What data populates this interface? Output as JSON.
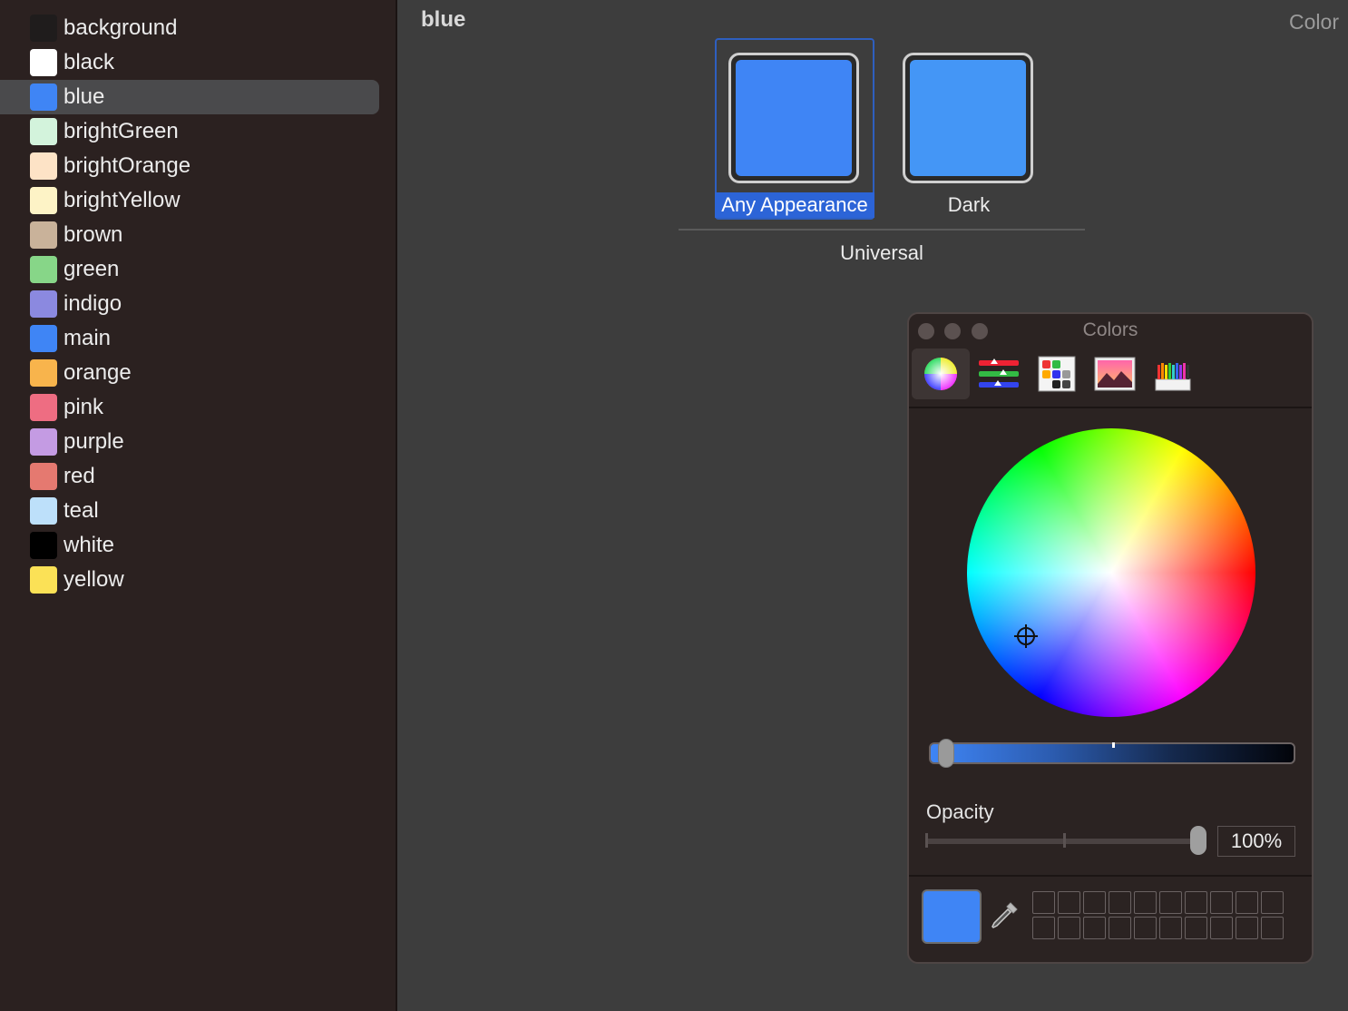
{
  "window": {
    "title": "blue",
    "inspector_title": "Color"
  },
  "sidebar": {
    "selected_index": 2,
    "items": [
      {
        "label": "background",
        "swatch": "#1f1c1c"
      },
      {
        "label": "black",
        "swatch": "#ffffff"
      },
      {
        "label": "blue",
        "swatch": "#3f85f5"
      },
      {
        "label": "brightGreen",
        "swatch": "#d3f3dc"
      },
      {
        "label": "brightOrange",
        "swatch": "#fde3c6"
      },
      {
        "label": "brightYellow",
        "swatch": "#fdf3c6"
      },
      {
        "label": "brown",
        "swatch": "#c9b29a"
      },
      {
        "label": "green",
        "swatch": "#87d688"
      },
      {
        "label": "indigo",
        "swatch": "#8b89e0"
      },
      {
        "label": "main",
        "swatch": "#3f85f5"
      },
      {
        "label": "orange",
        "swatch": "#f8b44c"
      },
      {
        "label": "pink",
        "swatch": "#ee6d82"
      },
      {
        "label": "purple",
        "swatch": "#c49be3"
      },
      {
        "label": "red",
        "swatch": "#e57970"
      },
      {
        "label": "teal",
        "swatch": "#bde0fa"
      },
      {
        "label": "white",
        "swatch": "#000000"
      },
      {
        "label": "yellow",
        "swatch": "#fbe156"
      }
    ]
  },
  "appearances": {
    "any": {
      "label": "Any Appearance",
      "color": "#3f85f5"
    },
    "dark": {
      "label": "Dark",
      "color": "#4496f6"
    },
    "group_label": "Universal"
  },
  "colors_panel": {
    "title": "Colors",
    "modes": [
      "color-wheel",
      "color-sliders",
      "color-palettes",
      "image-palettes",
      "pencils"
    ],
    "active_mode": "color-wheel",
    "brightness": 0.95,
    "opacity_label": "Opacity",
    "opacity_value": "100%",
    "current_color": "#3f85f5"
  }
}
